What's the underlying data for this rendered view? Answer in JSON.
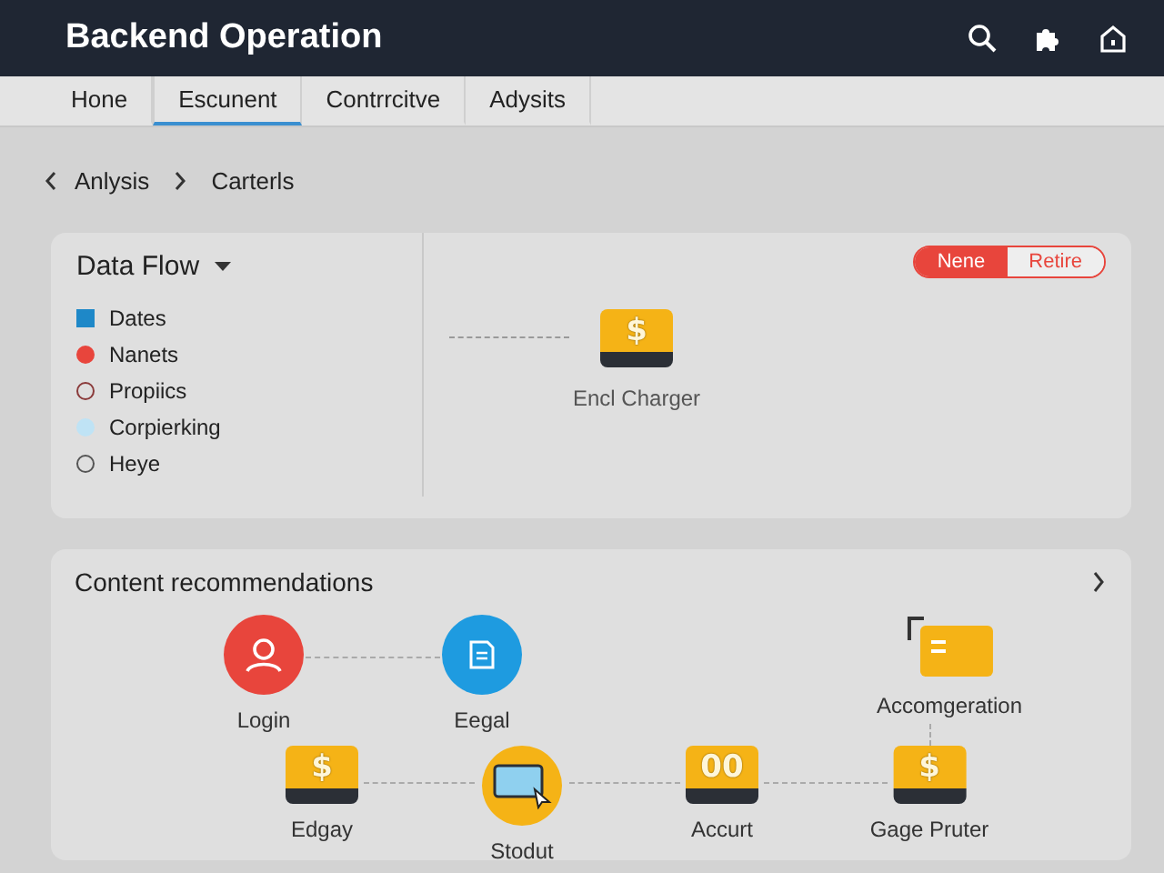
{
  "header": {
    "title": "Backend Operation"
  },
  "tabs": [
    {
      "label": "Hone",
      "selected": false
    },
    {
      "label": "Escunent",
      "selected": true
    },
    {
      "label": "Contrrcitve",
      "selected": false
    },
    {
      "label": "Adysits",
      "selected": false
    }
  ],
  "breadcrumb": [
    "Anlysis",
    "Carterls"
  ],
  "data_flow": {
    "title": "Data Flow",
    "legend": [
      {
        "label": "Dates",
        "kind": "square",
        "color": "#1e88c8"
      },
      {
        "label": "Nanets",
        "kind": "dot",
        "color": "#e8453c"
      },
      {
        "label": "Propiics",
        "kind": "ring",
        "color": "#8a3a3a"
      },
      {
        "label": "Corpierking",
        "kind": "dot",
        "color": "#bfe3f5"
      },
      {
        "label": "Heye",
        "kind": "ring",
        "color": "#555555"
      }
    ],
    "toggle": [
      {
        "label": "Nene",
        "selected": true
      },
      {
        "label": "Retire",
        "selected": false
      }
    ],
    "node": {
      "label": "Encl Charger",
      "symbol": "$"
    }
  },
  "recommendations": {
    "title": "Content recommendations",
    "nodes": [
      {
        "label": "Login",
        "kind": "person"
      },
      {
        "label": "Eegal",
        "kind": "document"
      },
      {
        "label": "Accomgeration",
        "kind": "folder"
      },
      {
        "label": "Edgay",
        "kind": "tablet",
        "symbol": "$"
      },
      {
        "label": "Stodut",
        "kind": "screen"
      },
      {
        "label": "Accurt",
        "kind": "tablet",
        "symbol": "00"
      },
      {
        "label": "Gage Pruter",
        "kind": "tablet",
        "symbol": "$"
      }
    ]
  }
}
